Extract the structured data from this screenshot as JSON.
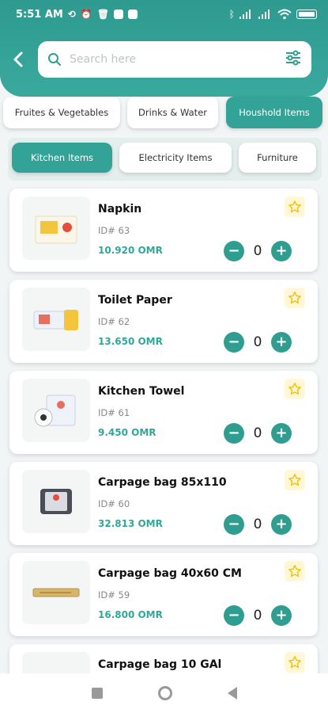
{
  "status_bar": {
    "time": "5:51 AM",
    "battery": "89"
  },
  "search": {
    "placeholder": "Search here"
  },
  "categories": [
    {
      "label": "Fruites & Vegetables",
      "active": false
    },
    {
      "label": "Drinks & Water",
      "active": false
    },
    {
      "label": "Houshold Items",
      "active": true
    }
  ],
  "subcategories": [
    {
      "label": "Kitchen Items",
      "active": true
    },
    {
      "label": "Electricity Items",
      "active": false
    },
    {
      "label": "Furniture",
      "active": false
    }
  ],
  "products": [
    {
      "name": "Napkin",
      "id": "ID# 63",
      "price": "10.920 OMR",
      "qty": "0"
    },
    {
      "name": "Toilet Paper",
      "id": "ID# 62",
      "price": "13.650 OMR",
      "qty": "0"
    },
    {
      "name": "Kitchen Towel",
      "id": "ID# 61",
      "price": "9.450 OMR",
      "qty": "0"
    },
    {
      "name": "Carpage bag 85x110",
      "id": "ID# 60",
      "price": "32.813 OMR",
      "qty": "0"
    },
    {
      "name": "Carpage bag 40x60 CM",
      "id": "ID# 59",
      "price": "16.800 OMR",
      "qty": "0"
    },
    {
      "name": "Carpage bag 10 GAl",
      "id": "",
      "price": "",
      "qty": ""
    }
  ],
  "stepper": {
    "minus": "−",
    "plus": "+"
  },
  "colors": {
    "accent": "#34a397",
    "price": "#2fa89b",
    "favorite": "#f2c316"
  }
}
